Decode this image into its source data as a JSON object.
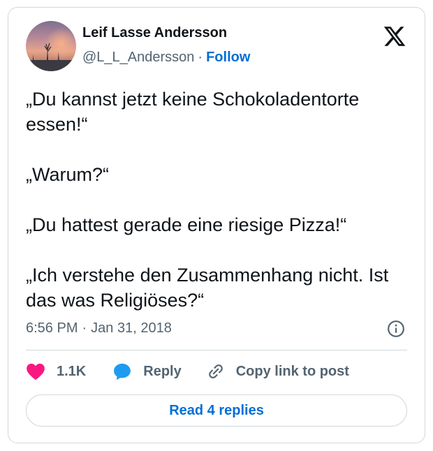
{
  "author": {
    "name": "Leif Lasse Andersson",
    "handle": "@L_L_Andersson",
    "separator": "·",
    "follow_label": "Follow"
  },
  "tweet": {
    "paragraphs": [
      "„Du kannst jetzt keine Schokoladentorte essen!“",
      "„Warum?“",
      "„Du hattest gerade eine riesige Pizza!“",
      "„Ich verstehe den Zusammenhang nicht. Ist das was Religiöses?“"
    ],
    "time": "6:56 PM",
    "separator": "·",
    "date": "Jan 31, 2018"
  },
  "actions": {
    "like_count": "1.1K",
    "reply_label": "Reply",
    "copy_label": "Copy link to post"
  },
  "read_replies_label": "Read 4 replies",
  "icons": {
    "logo": "x-logo-icon",
    "info": "info-icon",
    "like": "heart-icon",
    "reply": "speech-bubble-icon",
    "copy": "link-icon"
  },
  "colors": {
    "link": "#006fd6",
    "heart": "#f91880",
    "reply_bubble": "#1d9bf0",
    "muted": "#536471",
    "border": "#cfd9de"
  }
}
